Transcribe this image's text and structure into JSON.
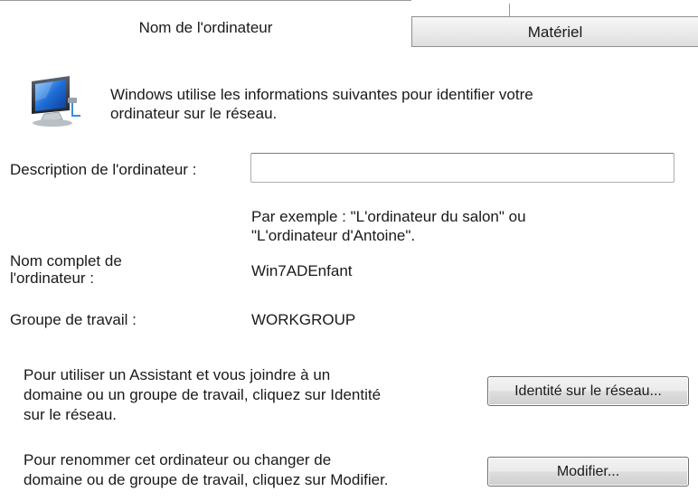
{
  "tabs": [
    {
      "label": "Nom de l'ordinateur",
      "active": true
    },
    {
      "label": "Matériel",
      "active": false
    }
  ],
  "intro": {
    "icon": "computer-network-icon",
    "lines": [
      "Windows utilise les informations suivantes pour identifier votre",
      "ordinateur sur le réseau."
    ]
  },
  "description": {
    "label": "Description de l'ordinateur :",
    "value": "",
    "example_lines": [
      "Par exemple : \"L'ordinateur du salon\" ou",
      "\"L'ordinateur d'Antoine\"."
    ]
  },
  "full_name": {
    "label_lines": [
      "Nom complet de",
      "l'ordinateur :"
    ],
    "value": "Win7ADEnfant"
  },
  "workgroup": {
    "label": "Groupe de travail :",
    "value": "WORKGROUP"
  },
  "network_id": {
    "text_lines": [
      "Pour utiliser un Assistant et vous joindre à un",
      "domaine ou un groupe de travail, cliquez sur Identité",
      "sur le réseau."
    ],
    "button_label": "Identité sur le réseau..."
  },
  "rename": {
    "text_lines": [
      "Pour renommer cet ordinateur ou changer de",
      "domaine ou de groupe de travail, cliquez sur Modifier."
    ],
    "button_label": "Modifier..."
  }
}
